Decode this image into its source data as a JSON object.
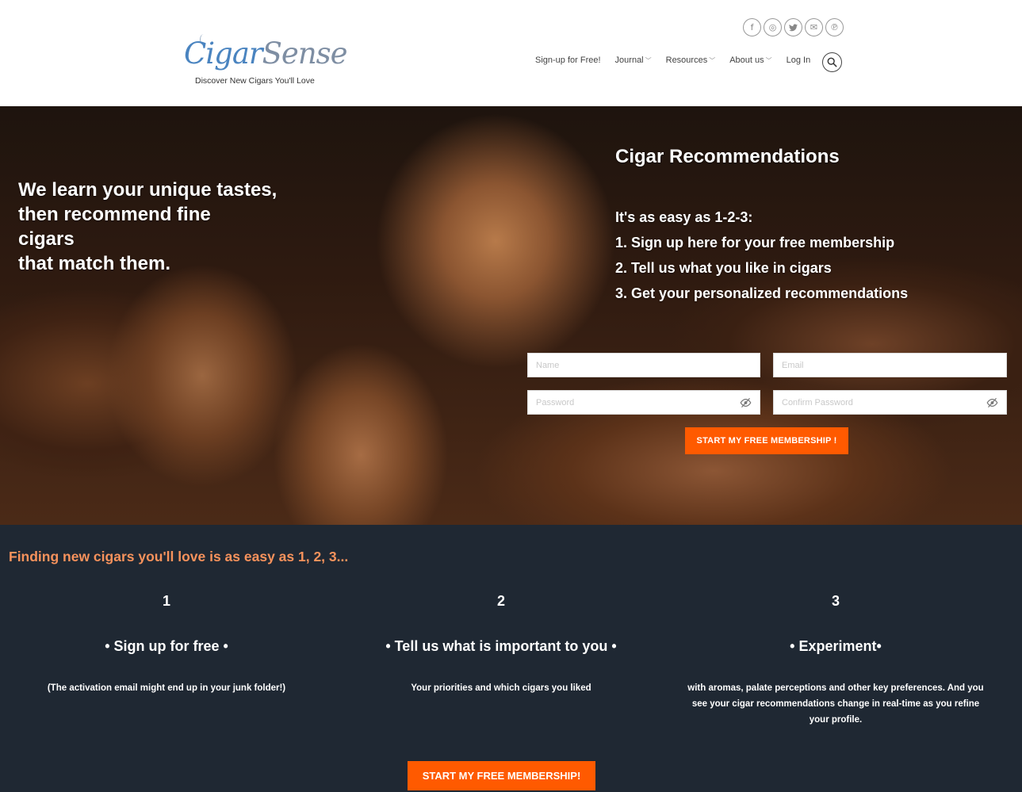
{
  "header": {
    "logo": {
      "word1": "Cigar",
      "word2": "Sense",
      "tagline": "Discover New Cigars You'll Love"
    },
    "social_icons": [
      {
        "name": "facebook-icon",
        "glyph": "f"
      },
      {
        "name": "instagram-icon",
        "glyph": "◎"
      },
      {
        "name": "twitter-icon",
        "glyph": "🐦"
      },
      {
        "name": "email-icon",
        "glyph": "✉"
      },
      {
        "name": "pinterest-icon",
        "glyph": "℗"
      }
    ],
    "nav": [
      {
        "label": "Sign-up for Free!",
        "dropdown": false
      },
      {
        "label": "Journal",
        "dropdown": true
      },
      {
        "label": "Resources",
        "dropdown": true
      },
      {
        "label": "About us",
        "dropdown": true
      },
      {
        "label": "Log In",
        "dropdown": false
      }
    ]
  },
  "hero": {
    "tagline_lines": [
      "We learn your unique tastes,",
      "then recommend fine",
      "cigars",
      "that match them."
    ],
    "title": "Cigar Recommendations",
    "steps_intro": "It's as easy as 1-2-3:",
    "steps": [
      "1. Sign up here for your free membership",
      "2. Tell us what you like in cigars",
      "3. Get your personalized recommendations"
    ],
    "form": {
      "name_placeholder": "Name",
      "email_placeholder": "Email",
      "password_placeholder": "Password",
      "confirm_placeholder": "Confirm Password",
      "submit_label": "START MY FREE MEMBERSHIP !"
    }
  },
  "steps_section": {
    "title": "Finding new cigars you'll love is as easy as 1, 2, 3...",
    "columns": [
      {
        "number": "1",
        "heading": "• Sign up for free •",
        "description": "(The activation email might end up in your junk folder!)"
      },
      {
        "number": "2",
        "heading": "• Tell us what is important to you •",
        "description": "Your priorities and which cigars you liked"
      },
      {
        "number": "3",
        "heading": "• Experiment•",
        "description": "with aromas, palate perceptions and other key preferences. And you see your cigar recommendations change in real-time as you refine your profile."
      }
    ],
    "cta_label": "START MY FREE MEMBERSHIP!"
  },
  "colors": {
    "accent": "#ff5a00",
    "section_bg": "#1f2833",
    "section_title": "#f7925c"
  }
}
